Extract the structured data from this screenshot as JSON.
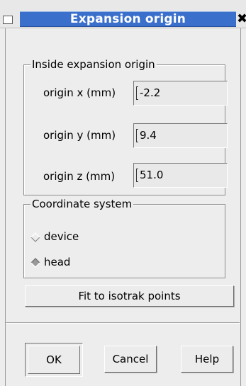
{
  "window": {
    "title": "Expansion origin",
    "close_glyph": "✖"
  },
  "origin_group": {
    "legend": "Inside expansion origin",
    "fields": [
      {
        "label": "origin x (mm)",
        "value": "-2.2"
      },
      {
        "label": "origin y (mm)",
        "value": "9.4"
      },
      {
        "label": "origin z (mm)",
        "value": "51.0"
      }
    ]
  },
  "coords_group": {
    "legend": "Coordinate system",
    "options": [
      {
        "label": "device",
        "selected": false
      },
      {
        "label": "head",
        "selected": true
      }
    ]
  },
  "fit_button_label": "Fit to isotrak points",
  "buttons": {
    "ok": "OK",
    "cancel": "Cancel",
    "help": "Help"
  },
  "colors": {
    "title_bar": "#3a6fcc",
    "background": "#ededed"
  },
  "icons": {
    "window_menu": "window-menu-icon",
    "close": "close-icon",
    "radio": "diamond-radio-icon"
  }
}
